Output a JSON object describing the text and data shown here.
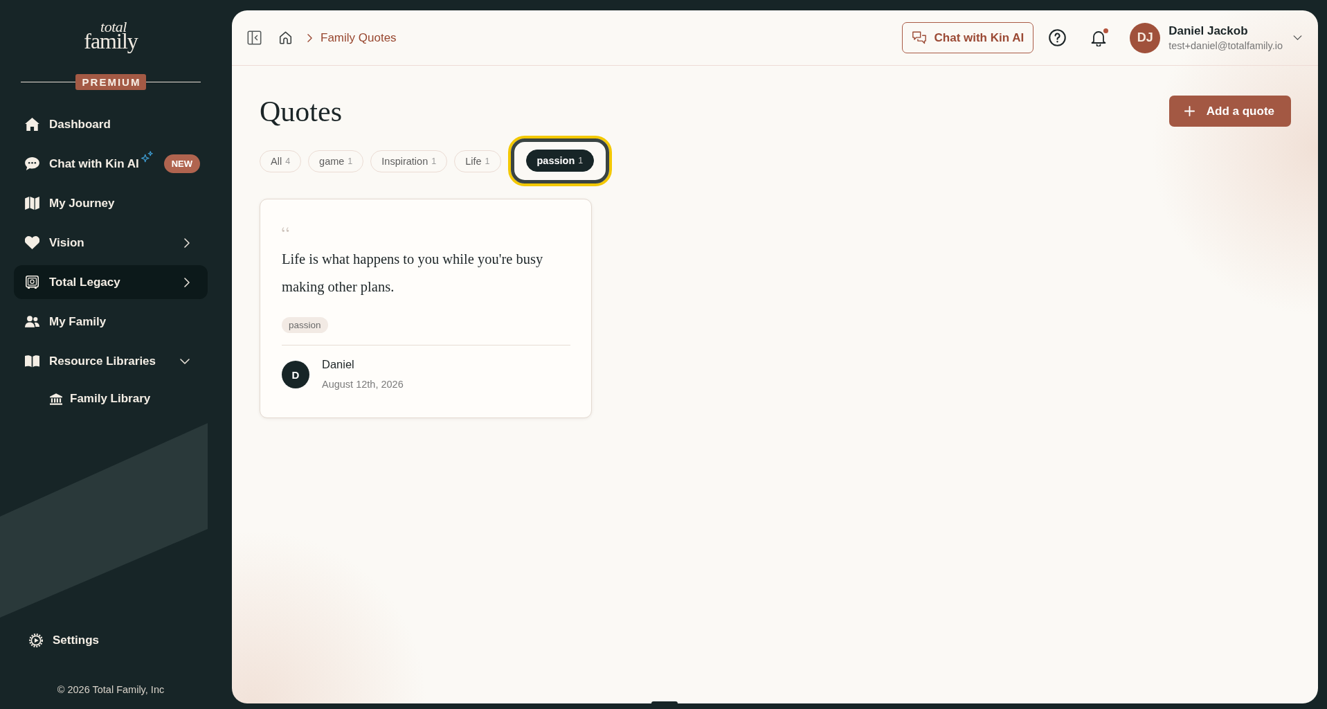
{
  "sidebar": {
    "logo": {
      "line_1": "total",
      "line_2": "family"
    },
    "plan_badge": "PREMIUM",
    "nav": [
      {
        "label": "Dashboard",
        "selected": false
      },
      {
        "label": "Chat with Kin AI",
        "badge": "NEW",
        "selected": false
      },
      {
        "label": "My Journey",
        "selected": false
      },
      {
        "label": "Vision",
        "expanded": false,
        "selected": false
      },
      {
        "label": "Total Legacy",
        "expanded": false,
        "selected": true
      },
      {
        "label": "My Family",
        "selected": false
      },
      {
        "label": "Resource Libraries",
        "expanded": true,
        "selected": false,
        "children": [
          {
            "label": "Family Library",
            "selected": false
          }
        ]
      }
    ],
    "settings": "Settings",
    "copyright": "© 2026 Total Family, Inc"
  },
  "header": {
    "breadcrumb": {
      "current": "Family Quotes"
    },
    "chat_button": "Chat with Kin AI",
    "notifications": {
      "unread": true
    },
    "user": {
      "initials": "DJ",
      "name": "Daniel Jackob",
      "email": "test+daniel@totalfamily.io"
    }
  },
  "page": {
    "title": "Quotes",
    "add_button": "Add a quote",
    "filters": [
      {
        "label": "All",
        "count": "4",
        "selected": false,
        "focused": false
      },
      {
        "label": "game",
        "count": "1",
        "selected": false,
        "focused": false
      },
      {
        "label": "Inspiration",
        "count": "1",
        "selected": false,
        "focused": false
      },
      {
        "label": "Life",
        "count": "1",
        "selected": false,
        "focused": false
      },
      {
        "label": "passion",
        "count": "1",
        "selected": true,
        "focused": true
      }
    ],
    "quotes": [
      {
        "text": "Life is what happens to you while you're busy making other plans.",
        "tags": [
          "passion"
        ],
        "author": {
          "initial": "D",
          "name": "Daniel"
        },
        "date": "August 12th, 2026"
      }
    ]
  }
}
